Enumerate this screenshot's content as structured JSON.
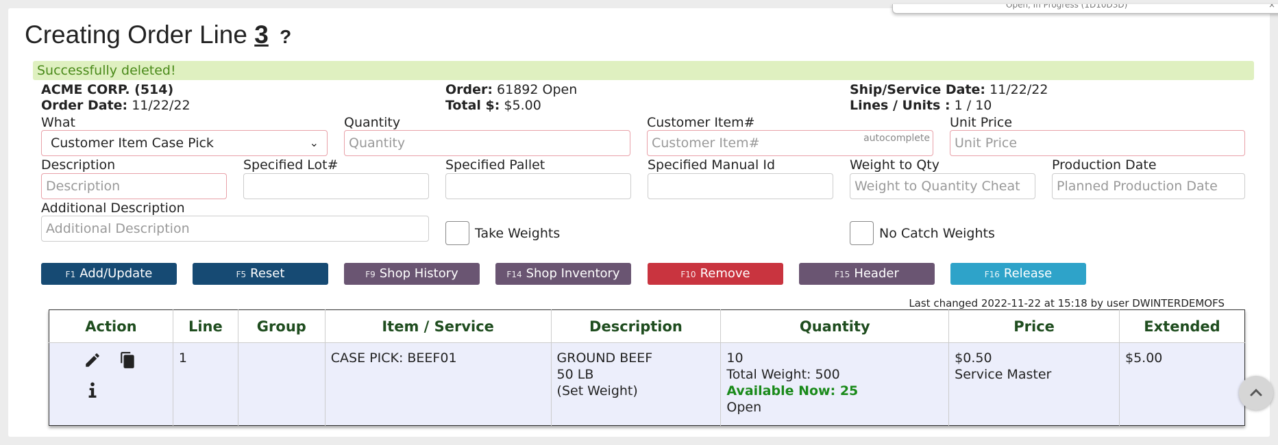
{
  "popup": {
    "text": "Open, In Progress (1D10D3D)",
    "close": "×"
  },
  "title": {
    "prefix": "Creating Order Line",
    "line_number": "3",
    "help": "?"
  },
  "alert": "Successfully deleted!",
  "order_info": {
    "customer": "ACME CORP. (514)",
    "order_date_label": "Order Date:",
    "order_date": "11/22/22",
    "order_label": "Order:",
    "order_value": "61892 Open",
    "total_label": "Total $:",
    "total_value": "$5.00",
    "ship_label": "Ship/Service Date:",
    "ship_value": "11/22/22",
    "lines_label": "Lines / Units :",
    "lines_value": "1 / 10"
  },
  "form": {
    "what_label": "What",
    "what_value": "Customer Item Case Pick",
    "quantity_label": "Quantity",
    "quantity_placeholder": "Quantity",
    "customer_item_label": "Customer Item#",
    "customer_item_placeholder": "Customer Item#",
    "autocomplete": "autocomplete",
    "unit_price_label": "Unit Price",
    "unit_price_placeholder": "Unit Price",
    "description_label": "Description",
    "description_placeholder": "Description",
    "lot_label": "Specified Lot#",
    "pallet_label": "Specified Pallet",
    "manual_id_label": "Specified Manual Id",
    "weight_qty_label": "Weight to Qty",
    "weight_qty_placeholder": "Weight to Quantity Cheat",
    "production_date_label": "Production Date",
    "production_date_placeholder": "Planned Production Date",
    "additional_label": "Additional Description",
    "additional_placeholder": "Additional Description",
    "take_weights_label": "Take Weights",
    "no_catch_label": "No Catch Weights"
  },
  "buttons": [
    {
      "key": "F1",
      "label": "Add/Update",
      "color": "#164a73"
    },
    {
      "key": "F5",
      "label": "Reset",
      "color": "#164a73"
    },
    {
      "key": "F9",
      "label": "Shop History",
      "color": "#6a5572"
    },
    {
      "key": "F14",
      "label": "Shop Inventory",
      "color": "#6a5572"
    },
    {
      "key": "F10",
      "label": "Remove",
      "color": "#c9343f"
    },
    {
      "key": "F15",
      "label": "Header",
      "color": "#6a5572"
    },
    {
      "key": "F16",
      "label": "Release",
      "color": "#2ea3c9"
    }
  ],
  "last_changed": "Last changed 2022-11-22 at 15:18 by user DWINTERDEMOFS",
  "table": {
    "headers": [
      "Action",
      "Line",
      "Group",
      "Item / Service",
      "Description",
      "Quantity",
      "Price",
      "Extended"
    ],
    "rows": [
      {
        "line": "1",
        "group": "",
        "item": "CASE PICK: BEEF01",
        "desc1": "GROUND BEEF",
        "desc2": "50 LB",
        "desc3": "(Set Weight)",
        "qty": "10",
        "total_weight": "Total Weight: 500",
        "available": "Available Now: 25",
        "status": "Open",
        "price": "$0.50",
        "price_note": "Service Master",
        "extended": "$5.00"
      }
    ]
  }
}
